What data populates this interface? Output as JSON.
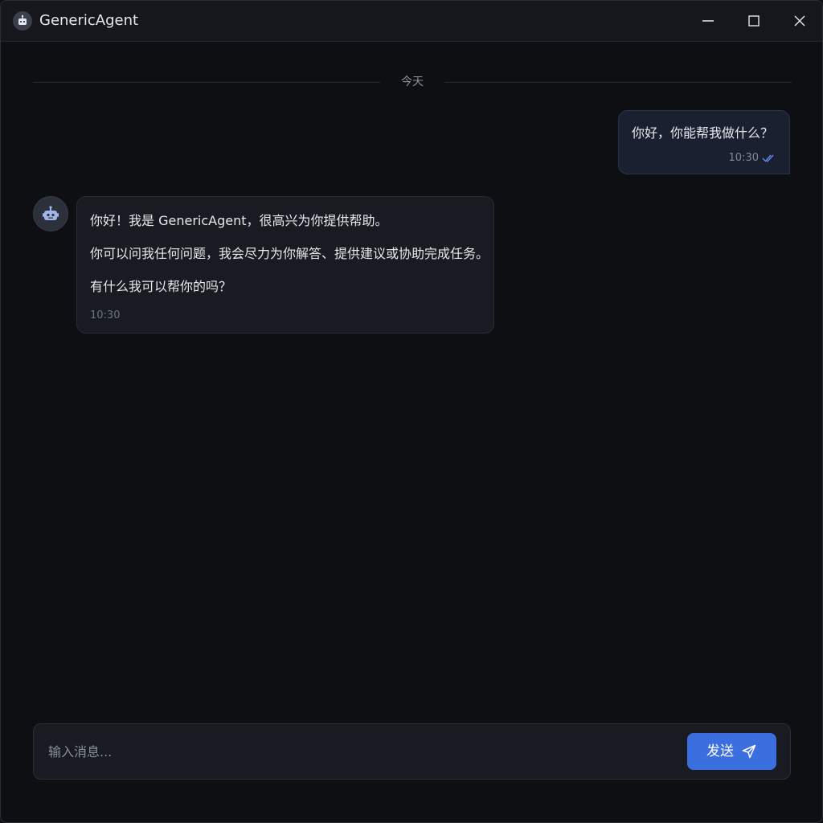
{
  "window": {
    "title": "GenericAgent",
    "icon": "robot-icon",
    "controls": [
      "minimize-icon",
      "maximize-icon",
      "close-icon"
    ]
  },
  "chat": {
    "date_divider": "今天",
    "messages": [
      {
        "role": "user",
        "text": "你好，你能帮我做什么？",
        "time": "10:30",
        "status_icon": "double-check-icon"
      },
      {
        "role": "assistant",
        "avatar_icon": "robot-icon",
        "lines": [
          "你好！我是 GenericAgent，很高兴为你提供帮助。",
          "你可以问我任何问题，我会尽力为你解答、提供建议或协助完成任务。",
          "有什么我可以帮你的吗？"
        ],
        "time": "10:30"
      }
    ]
  },
  "composer": {
    "value": "",
    "placeholder": "输入消息...",
    "send_label": "发送",
    "send_icon": "paper-plane-icon"
  },
  "colors": {
    "background": "#0d0f13",
    "accent": "#3b6fe0",
    "user_bubble": "#1a2030",
    "assistant_bubble": "#181b21"
  }
}
